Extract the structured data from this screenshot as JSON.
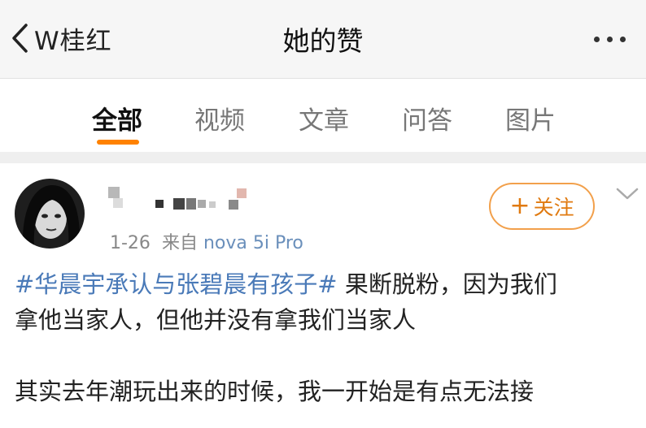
{
  "navbar": {
    "back_label": "W桂红",
    "title": "她的赞"
  },
  "tabs": [
    {
      "label": "全部",
      "active": true
    },
    {
      "label": "视频",
      "active": false
    },
    {
      "label": "文章",
      "active": false
    },
    {
      "label": "问答",
      "active": false
    },
    {
      "label": "图片",
      "active": false
    }
  ],
  "colors": {
    "accent": "#ff8200",
    "link": "#4a7ab8"
  },
  "post": {
    "date": "1-26",
    "source_prefix": "来自",
    "source": "nova 5i Pro",
    "follow_label": "关注",
    "hashtag": "#华晨宇承认与张碧晨有孩子#",
    "line1_rest": " 果断脱粉，因为我们",
    "line2": "拿他当家人，但他并没有拿我们当家人",
    "line4": "其实去年潮玩出来的时候，我一开始是有点无法接"
  }
}
